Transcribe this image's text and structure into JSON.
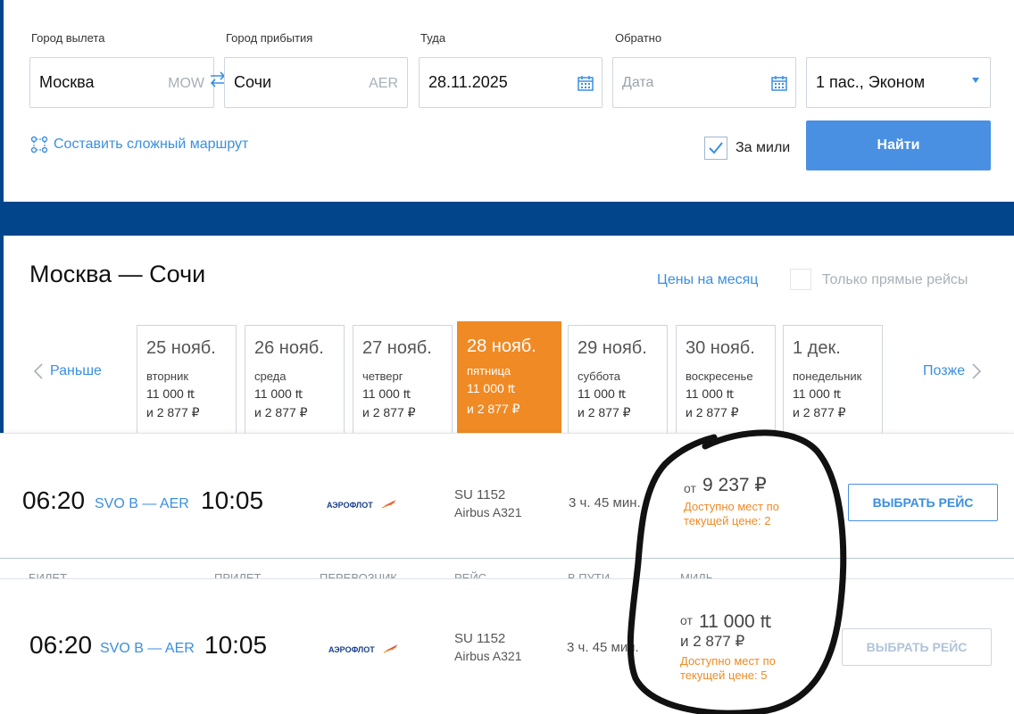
{
  "search": {
    "from_label": "Город вылета",
    "from_value": "Москва",
    "from_code": "MOW",
    "to_label": "Город прибытия",
    "to_value": "Сочи",
    "to_code": "AER",
    "depart_label": "Туда",
    "depart_value": "28.11.2025",
    "return_label": "Обратно",
    "return_placeholder": "Дата",
    "passengers": "1 пас., Эконом",
    "complex_route": "Составить сложный маршрут",
    "miles_label": "За мили",
    "miles_checked": true,
    "find_button": "Найти"
  },
  "results": {
    "title": "Москва — Сочи",
    "month_prices": "Цены на месяц",
    "direct_only": "Только прямые рейсы",
    "prev": "Раньше",
    "next": "Позже",
    "dates": [
      {
        "date": "25 нояб.",
        "weekday": "вторник",
        "miles": "11 000 ₶",
        "rub": "и 2 877 ₽"
      },
      {
        "date": "26 нояб.",
        "weekday": "среда",
        "miles": "11 000 ₶",
        "rub": "и 2 877 ₽"
      },
      {
        "date": "27 нояб.",
        "weekday": "четверг",
        "miles": "11 000 ₶",
        "rub": "и 2 877 ₽"
      },
      {
        "date": "28 нояб.",
        "weekday": "пятница",
        "miles": "11 000 ₶",
        "rub": "и 2 877 ₽",
        "active": true
      },
      {
        "date": "29 нояб.",
        "weekday": "суббота",
        "miles": "11 000 ₶",
        "rub": "и 2 877 ₽"
      },
      {
        "date": "30 нояб.",
        "weekday": "воскресенье",
        "miles": "11 000 ₶",
        "rub": "и 2 877 ₽"
      },
      {
        "date": "1 дек.",
        "weekday": "понедельник",
        "miles": "11 000 ₶",
        "rub": "и 2 877 ₽"
      }
    ]
  },
  "flights": [
    {
      "dep_time": "06:20",
      "route": "SVO B — AER",
      "arr_time": "10:05",
      "airline": "АЭРОФЛОТ",
      "flight_no": "SU 1152",
      "aircraft": "Airbus A321",
      "duration": "3 ч. 45 мин.",
      "price_from": "от",
      "price": "9 237 ₽",
      "seats": "Доступно мест по текущей цене: 2",
      "button": "ВЫБРАТЬ РЕЙС"
    },
    {
      "dep_time": "06:20",
      "route": "SVO B — AER",
      "arr_time": "10:05",
      "airline": "АЭРОФЛОТ",
      "flight_no": "SU 1152",
      "aircraft": "Airbus A321",
      "duration": "3 ч. 45 мин.",
      "price_from": "от",
      "price": "11 000 ₶",
      "price_rub": "и 2 877 ₽",
      "seats": "Доступно мест по текущей цене: 5",
      "button": "ВЫБРАТЬ РЕЙС"
    }
  ],
  "hidden_header": {
    "col1": "БИЛЕТ",
    "col2": "ПРИЛЕТ",
    "col3": "ПЕРЕВОЗЧИК",
    "col4": "РЕЙС",
    "col5": "В ПУТИ",
    "col6": "МИЛЬ"
  },
  "colors": {
    "brand_blue": "#02458b",
    "accent_blue": "#4a90e2",
    "link_blue": "#3a8fe0",
    "orange": "#f08a24"
  }
}
